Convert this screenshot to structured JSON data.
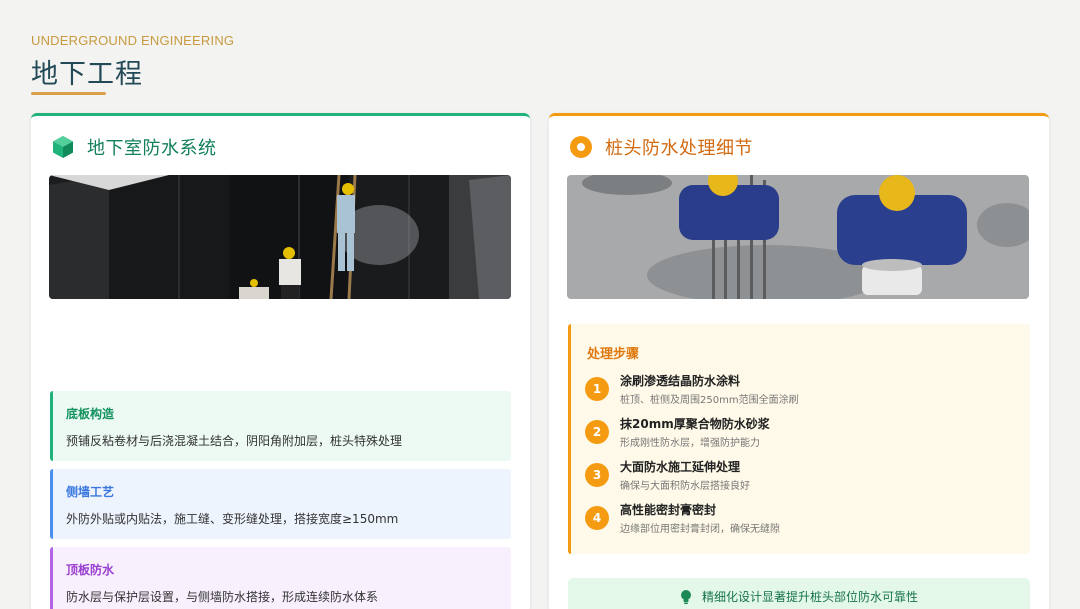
{
  "header": {
    "eyebrow": "UNDERGROUND ENGINEERING",
    "title": "地下工程"
  },
  "colors": {
    "accent_gold": "#d9a04a",
    "green": "#1fb27a",
    "orange": "#f29a11",
    "blue": "#4c8ef0",
    "purple": "#b462e6"
  },
  "left_card": {
    "icon": "cube-icon",
    "title": "地下室防水系统",
    "photo": "basement-waterproofing-photo",
    "items": [
      {
        "title": "底板构造",
        "text": "预铺反粘卷材与后浇混凝土结合，阴阳角附加层，桩头特殊处理"
      },
      {
        "title": "侧墙工艺",
        "text": "外防外贴或内贴法，施工缝、变形缝处理，搭接宽度≥150mm"
      },
      {
        "title": "顶板防水",
        "text": "防水层与保护层设置，与侧墙防水搭接，形成连续防水体系"
      }
    ]
  },
  "right_card": {
    "icon": "ring-icon",
    "title": "桩头防水处理细节",
    "photo": "pile-head-treatment-photo",
    "steps_title": "处理步骤",
    "steps": [
      {
        "num": "1",
        "title": "涂刷渗透结晶防水涂料",
        "desc": "桩顶、桩侧及周围250mm范围全面涂刷"
      },
      {
        "num": "2",
        "title": "抹20mm厚聚合物防水砂浆",
        "desc": "形成刚性防水层，增强防护能力"
      },
      {
        "num": "3",
        "title": "大面防水施工延伸处理",
        "desc": "确保与大面积防水层搭接良好"
      },
      {
        "num": "4",
        "title": "高性能密封膏密封",
        "desc": "边缘部位用密封膏封闭，确保无缝隙"
      }
    ],
    "tip_icon": "lightbulb-icon",
    "tip": "精细化设计显著提升桩头部位防水可靠性"
  }
}
